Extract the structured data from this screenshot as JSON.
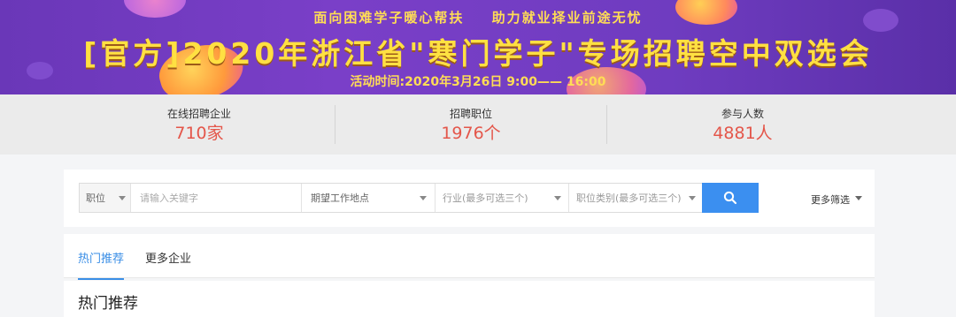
{
  "banner": {
    "subtitle_left": "面向困难学子暖心帮扶",
    "subtitle_right": "助力就业择业前途无忧",
    "title": "[官方]2020年浙江省\"寒门学子\"专场招聘空中双选会",
    "time": "活动时间:2020年3月26日 9:00—— 16:00"
  },
  "stats": [
    {
      "label": "在线招聘企业",
      "value": "710家"
    },
    {
      "label": "招聘职位",
      "value": "1976个"
    },
    {
      "label": "参与人数",
      "value": "4881人"
    }
  ],
  "search": {
    "type_label": "职位",
    "keyword_placeholder": "请输入关键字",
    "location_label": "期望工作地点",
    "industry_label": "行业(最多可选三个)",
    "category_label": "职位类别(最多可选三个)",
    "more_filter": "更多筛选"
  },
  "tabs": [
    {
      "label": "热门推荐",
      "active": true
    },
    {
      "label": "更多企业",
      "active": false
    }
  ],
  "section": {
    "title": "热门推荐"
  },
  "colors": {
    "accent": "#3b8ff0",
    "stat_value": "#e4564a",
    "banner_text": "#ffe042"
  }
}
